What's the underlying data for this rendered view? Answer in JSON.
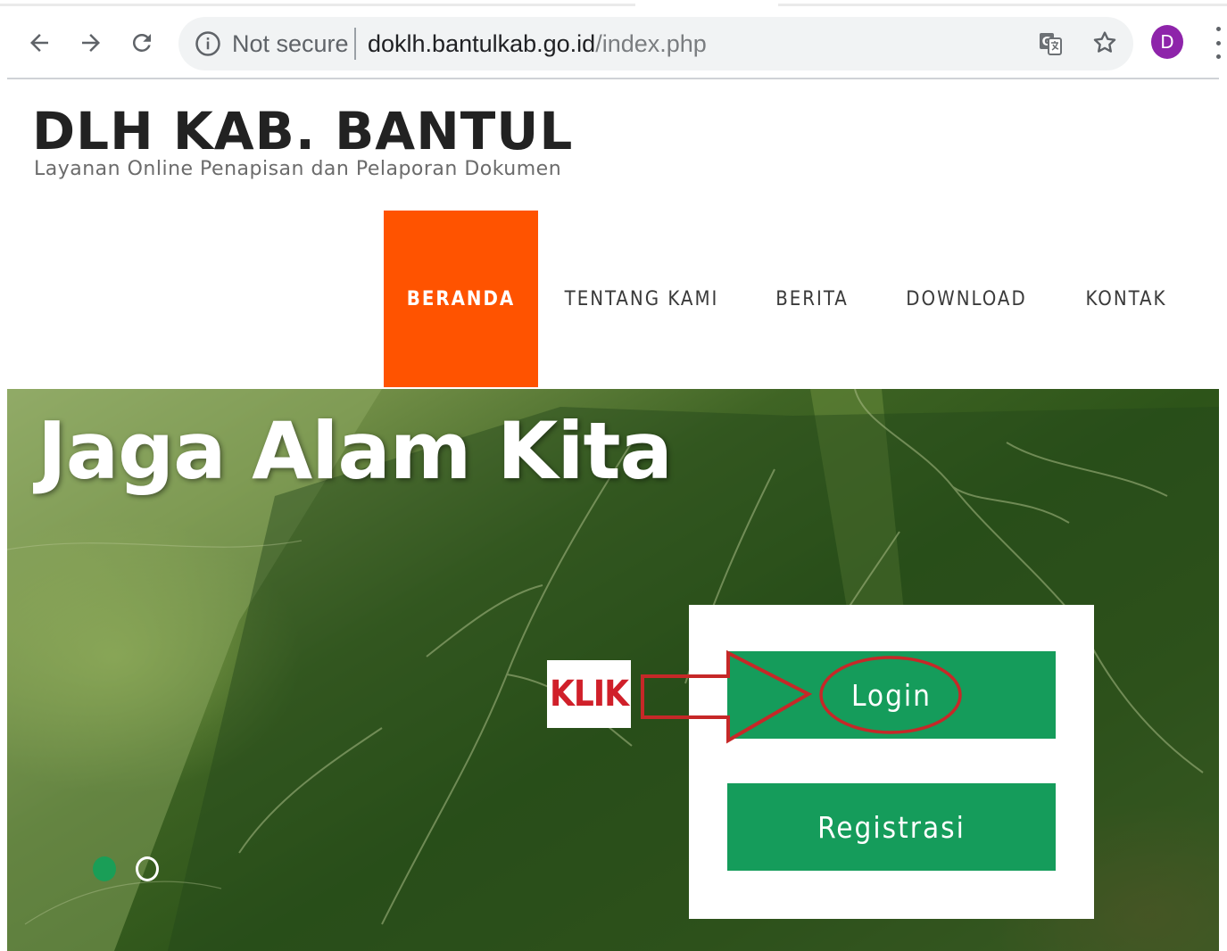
{
  "browser": {
    "back_icon": "arrow-left-icon",
    "forward_icon": "arrow-right-icon",
    "reload_icon": "reload-icon",
    "security_label": "Not secure",
    "url_domain": "doklh.bantulkab.go.id",
    "url_path": "/index.php",
    "translate_icon": "translate-icon",
    "bookmark_icon": "star-icon",
    "profile_initial": "D",
    "profile_color": "#8e24aa"
  },
  "site": {
    "title": "DLH KAB. BANTUL",
    "subtitle": "Layanan Online Penapisan dan Pelaporan Dokumen"
  },
  "nav": {
    "items": [
      {
        "label": "BERANDA",
        "active": true
      },
      {
        "label": "TENTANG KAMI",
        "active": false
      },
      {
        "label": "BERITA",
        "active": false
      },
      {
        "label": "DOWNLOAD",
        "active": false
      },
      {
        "label": "KONTAK",
        "active": false
      }
    ],
    "active_color": "#ff5300"
  },
  "hero": {
    "headline": "Jaga Alam Kita",
    "slides_total": 2,
    "slide_active": 1,
    "annotation_label": "KLIK",
    "annotation_color": "#d0202a",
    "buttons": {
      "login": "Login",
      "register": "Registrasi"
    },
    "button_color": "#159c5b"
  }
}
